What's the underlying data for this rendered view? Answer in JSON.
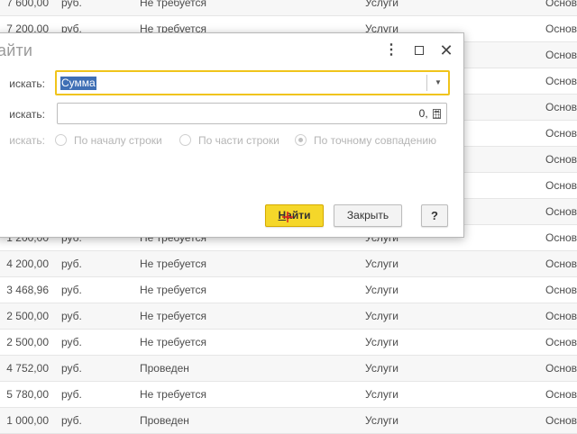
{
  "table": {
    "rows": [
      {
        "amount": "7 600,00",
        "currency": "руб.",
        "status": "Не требуется",
        "type": "Услуги",
        "basis": "Основ"
      },
      {
        "amount": "7 200,00",
        "currency": "руб.",
        "status": "Не требуется",
        "type": "Услуги",
        "basis": "Основ"
      },
      {
        "amount": "",
        "currency": "",
        "status": "",
        "type": "",
        "basis": "Основ"
      },
      {
        "amount": "",
        "currency": "",
        "status": "",
        "type": "",
        "basis": "Основ"
      },
      {
        "amount": "",
        "currency": "",
        "status": "",
        "type": "",
        "basis": "Основ"
      },
      {
        "amount": "",
        "currency": "",
        "status": "",
        "type": "",
        "basis": "Основ"
      },
      {
        "amount": "",
        "currency": "",
        "status": "",
        "type": "",
        "basis": "Основ"
      },
      {
        "amount": "",
        "currency": "",
        "status": "",
        "type": "",
        "basis": "Основ"
      },
      {
        "amount": "",
        "currency": "",
        "status": "",
        "type": "",
        "basis": "Основ"
      },
      {
        "amount": "1 200,00",
        "currency": "руб.",
        "status": "Не требуется",
        "type": "Услуги",
        "basis": "Основ"
      },
      {
        "amount": "4 200,00",
        "currency": "руб.",
        "status": "Не требуется",
        "type": "Услуги",
        "basis": "Основ"
      },
      {
        "amount": "3 468,96",
        "currency": "руб.",
        "status": "Не требуется",
        "type": "Услуги",
        "basis": "Основ"
      },
      {
        "amount": "2 500,00",
        "currency": "руб.",
        "status": "Не требуется",
        "type": "Услуги",
        "basis": "Основ"
      },
      {
        "amount": "2 500,00",
        "currency": "руб.",
        "status": "Не требуется",
        "type": "Услуги",
        "basis": "Основ"
      },
      {
        "amount": "4 752,00",
        "currency": "руб.",
        "status": "Проведен",
        "type": "Услуги",
        "basis": "Основ"
      },
      {
        "amount": "5 780,00",
        "currency": "руб.",
        "status": "Не требуется",
        "type": "Услуги",
        "basis": "Основ"
      },
      {
        "amount": "1 000,00",
        "currency": "руб.",
        "status": "Проведен",
        "type": "Услуги",
        "basis": "Основ"
      }
    ]
  },
  "dialog": {
    "title": "айти",
    "search_where_label": "искать:",
    "search_where_value": "Сумма",
    "search_what_label": "искать:",
    "search_what_value": "0,00",
    "search_how_label": "искать:",
    "radio_options": [
      {
        "label": "По началу строки",
        "selected": false
      },
      {
        "label": "По части строки",
        "selected": false
      },
      {
        "label": "По точному совпадению",
        "selected": true
      }
    ],
    "find_button": "Найти",
    "find_button_hotkey": "Н",
    "find_button_rest": "айти",
    "close_button": "Закрыть",
    "help_button": "?",
    "icons": {
      "more": "more-vertical-icon",
      "maximize": "maximize-icon",
      "close": "close-icon",
      "dropdown": "chevron-down-icon",
      "calculator": "calculator-icon"
    }
  },
  "colors": {
    "accent_yellow": "#f5d72a",
    "focus_border": "#f0c41b",
    "selection_blue": "#3f6fb5"
  }
}
